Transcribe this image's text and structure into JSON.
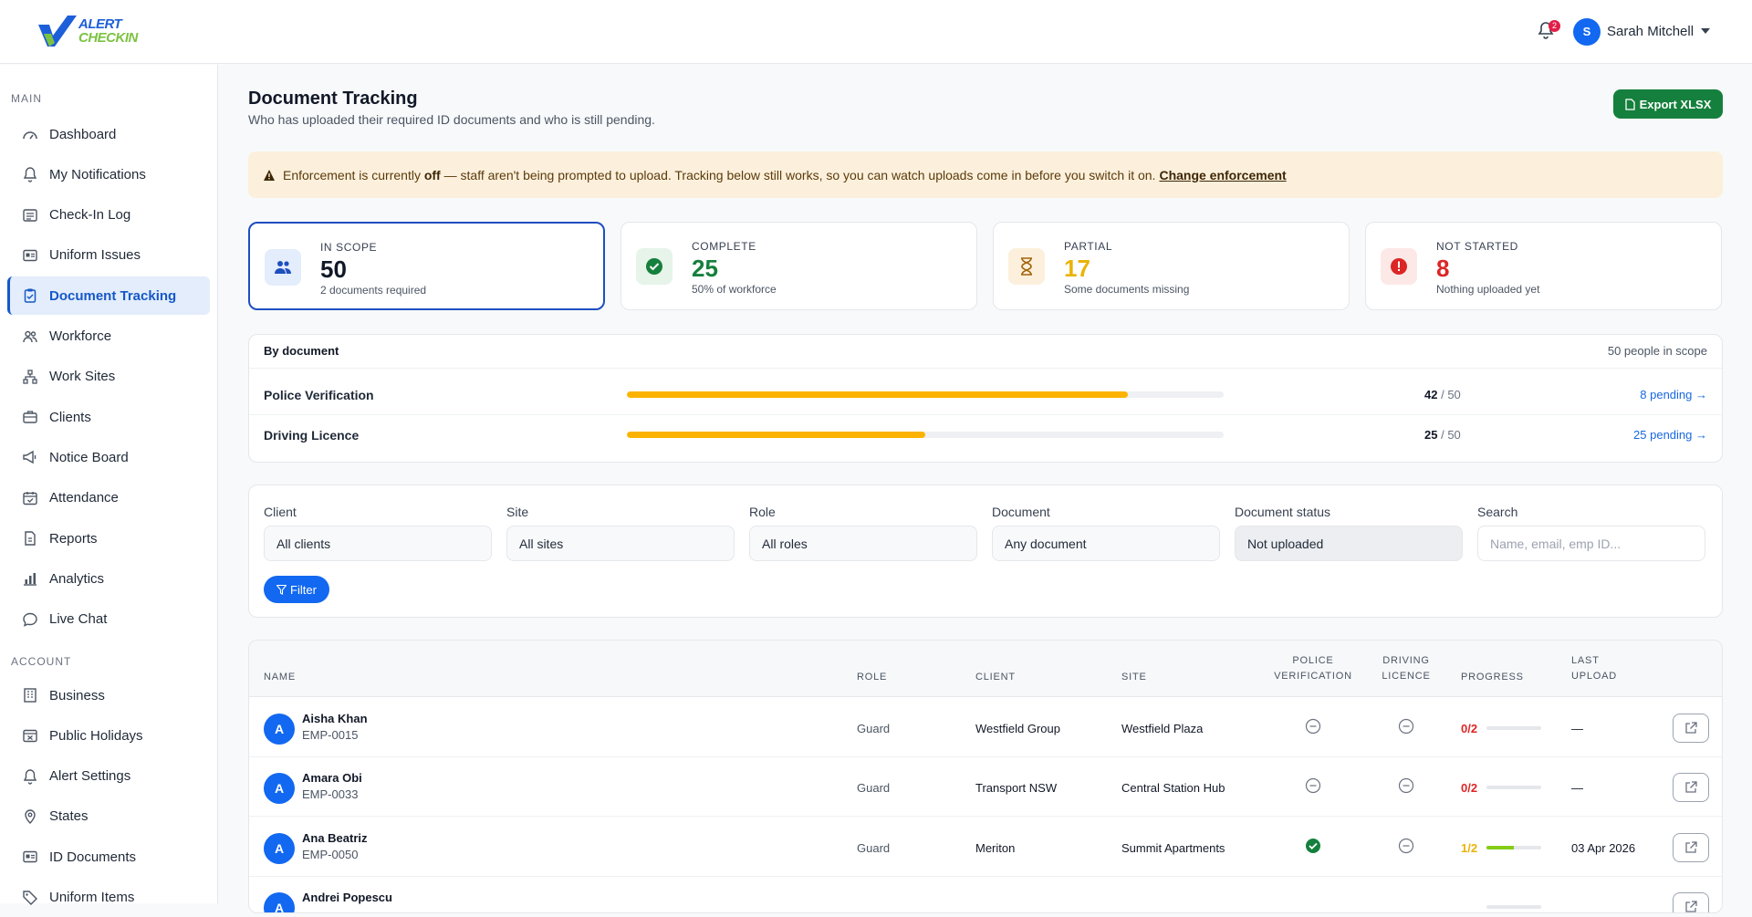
{
  "brand": {
    "line1": "ALERT",
    "line2": "CHECKIN"
  },
  "header": {
    "notification_count": "2",
    "user_initial": "S",
    "user_name": "Sarah Mitchell"
  },
  "sidebar": {
    "main_label": "MAIN",
    "main_items": [
      {
        "label": "Dashboard",
        "icon": "gauge-icon"
      },
      {
        "label": "My Notifications",
        "icon": "bell-icon"
      },
      {
        "label": "Check-In Log",
        "icon": "list-card-icon"
      },
      {
        "label": "Uniform Issues",
        "icon": "id-card-icon"
      },
      {
        "label": "Document Tracking",
        "icon": "clipboard-check-icon",
        "active": true
      },
      {
        "label": "Workforce",
        "icon": "people-icon"
      },
      {
        "label": "Work Sites",
        "icon": "sitemap-icon"
      },
      {
        "label": "Clients",
        "icon": "briefcase-icon"
      },
      {
        "label": "Notice Board",
        "icon": "megaphone-icon"
      },
      {
        "label": "Attendance",
        "icon": "calendar-check-icon"
      },
      {
        "label": "Reports",
        "icon": "report-icon"
      },
      {
        "label": "Analytics",
        "icon": "bar-chart-icon"
      },
      {
        "label": "Live Chat",
        "icon": "chat-icon"
      }
    ],
    "account_label": "ACCOUNT",
    "account_items": [
      {
        "label": "Business",
        "icon": "building-icon"
      },
      {
        "label": "Public Holidays",
        "icon": "calendar-x-icon"
      },
      {
        "label": "Alert Settings",
        "icon": "bell-icon"
      },
      {
        "label": "States",
        "icon": "map-pin-icon"
      },
      {
        "label": "ID Documents",
        "icon": "id-card-icon"
      },
      {
        "label": "Uniform Items",
        "icon": "tags-icon"
      }
    ]
  },
  "page": {
    "title": "Document Tracking",
    "subtitle": "Who has uploaded their required ID documents and who is still pending.",
    "export_label": "Export XLSX"
  },
  "alert": {
    "pre": "Enforcement is currently",
    "state": "off",
    "post": "— staff aren't being prompted to upload. Tracking below still works, so you can watch uploads come in before you switch it on.",
    "link": "Change enforcement"
  },
  "cards": [
    {
      "label": "IN SCOPE",
      "value": "50",
      "note": "2 documents required",
      "color": "#111827",
      "icon": "people-icon"
    },
    {
      "label": "COMPLETE",
      "value": "25",
      "note": "50% of workforce",
      "color": "#15803d",
      "icon": "check-circle-icon"
    },
    {
      "label": "PARTIAL",
      "value": "17",
      "note": "Some documents missing",
      "color": "#eab308",
      "icon": "hourglass-icon"
    },
    {
      "label": "NOT STARTED",
      "value": "8",
      "note": "Nothing uploaded yet",
      "color": "#dc2626",
      "icon": "exclamation-circle-icon"
    }
  ],
  "by_document": {
    "title": "By document",
    "scope_note": "50 people in scope",
    "rows": [
      {
        "name": "Police Verification",
        "uploaded": "42",
        "total": "/ 50",
        "fraction": 0.84,
        "pending": "8 pending →"
      },
      {
        "name": "Driving Licence",
        "uploaded": "25",
        "total": "/ 50",
        "fraction": 0.5,
        "pending": "25 pending →"
      }
    ]
  },
  "filters": {
    "client": {
      "label": "Client",
      "value": "All clients"
    },
    "site": {
      "label": "Site",
      "value": "All sites"
    },
    "role": {
      "label": "Role",
      "value": "All roles"
    },
    "document": {
      "label": "Document",
      "value": "Any document"
    },
    "status": {
      "label": "Document status",
      "value": "Not uploaded"
    },
    "search": {
      "label": "Search",
      "placeholder": "Name, email, emp ID..."
    },
    "button": "Filter"
  },
  "table": {
    "headers": {
      "name": "NAME",
      "role": "ROLE",
      "client": "CLIENT",
      "site": "SITE",
      "police_1": "POLICE",
      "police_2": "VERIFICATION",
      "driving_1": "DRIVING",
      "driving_2": "LICENCE",
      "progress": "PROGRESS",
      "last_1": "LAST",
      "last_2": "UPLOAD"
    },
    "rows": [
      {
        "initial": "A",
        "name": "Aisha Khan",
        "emp": "EMP-0015",
        "role": "Guard",
        "client": "Westfield Group",
        "site": "Westfield Plaza",
        "police": "missing",
        "driving": "missing",
        "progress": "0/2",
        "progress_fraction": 0,
        "progress_color": "#dc2626",
        "last_upload": "—"
      },
      {
        "initial": "A",
        "name": "Amara Obi",
        "emp": "EMP-0033",
        "role": "Guard",
        "client": "Transport NSW",
        "site": "Central Station Hub",
        "police": "missing",
        "driving": "missing",
        "progress": "0/2",
        "progress_fraction": 0,
        "progress_color": "#dc2626",
        "last_upload": "—"
      },
      {
        "initial": "A",
        "name": "Ana Beatriz",
        "emp": "EMP-0050",
        "role": "Guard",
        "client": "Meriton",
        "site": "Summit Apartments",
        "police": "uploaded",
        "driving": "missing",
        "progress": "1/2",
        "progress_fraction": 0.5,
        "progress_color": "#eab308",
        "last_upload": "03 Apr 2026"
      },
      {
        "initial": "A",
        "name": "Andrei Popescu",
        "emp": "",
        "role": "",
        "client": "",
        "site": "",
        "police": "",
        "driving": "",
        "progress": "",
        "progress_fraction": 0,
        "progress_color": "#eab308",
        "last_upload": ""
      }
    ]
  }
}
